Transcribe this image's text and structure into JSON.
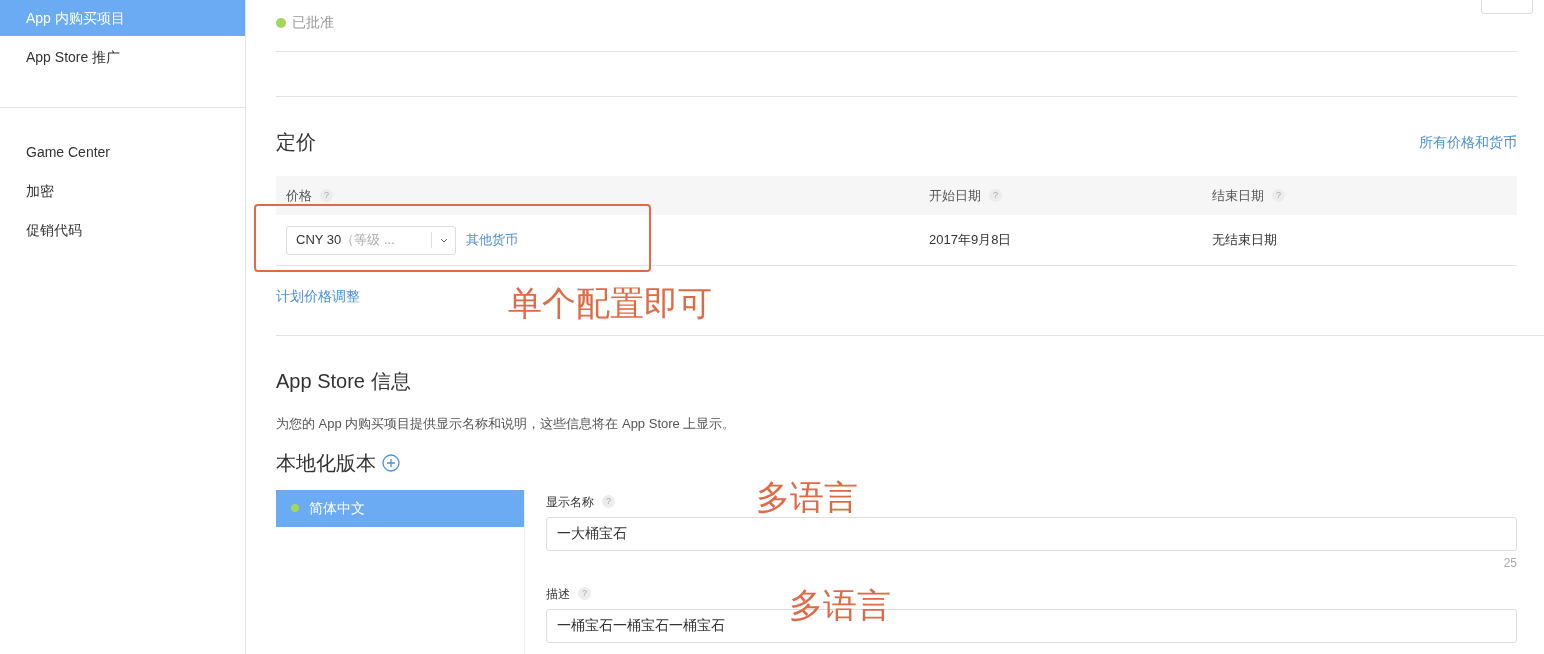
{
  "sidebar": {
    "groups": [
      [
        {
          "label": "App 内购买项目",
          "selected": true
        },
        {
          "label": "App Store 推广",
          "selected": false
        }
      ],
      [
        {
          "label": "Game Center",
          "selected": false
        },
        {
          "label": "加密",
          "selected": false
        },
        {
          "label": "促销代码",
          "selected": false
        }
      ]
    ]
  },
  "status": {
    "label": "已批准",
    "color": "#a3d65a"
  },
  "pricing": {
    "title": "定价",
    "link": "所有价格和货币",
    "columns": [
      {
        "label": "价格",
        "help": "?"
      },
      {
        "label": "开始日期",
        "help": "?"
      },
      {
        "label": "结束日期",
        "help": "?"
      }
    ],
    "row": {
      "price": "CNY 30",
      "price_hint": "（等级 ...",
      "other_link": "其他货币",
      "start": "2017年9月8日",
      "end": "无结束日期"
    },
    "schedule_link": "计划价格调整"
  },
  "store_info": {
    "title": "App Store 信息",
    "description": "为您的 App 内购买项目提供显示名称和说明，这些信息将在 App Store 上显示。",
    "localizations_title": "本地化版本",
    "locales": [
      {
        "label": "简体中文",
        "selected": true,
        "color": "#a3d65a"
      }
    ],
    "fields": [
      {
        "label": "显示名称",
        "help": "?",
        "value": "一大桶宝石",
        "counter": "25"
      },
      {
        "label": "描述",
        "help": "?",
        "value": "一桶宝石一桶宝石一桶宝石"
      }
    ]
  },
  "annotations": [
    {
      "text": "单个配置即可"
    },
    {
      "text": "多语言"
    },
    {
      "text": "多语言"
    }
  ]
}
